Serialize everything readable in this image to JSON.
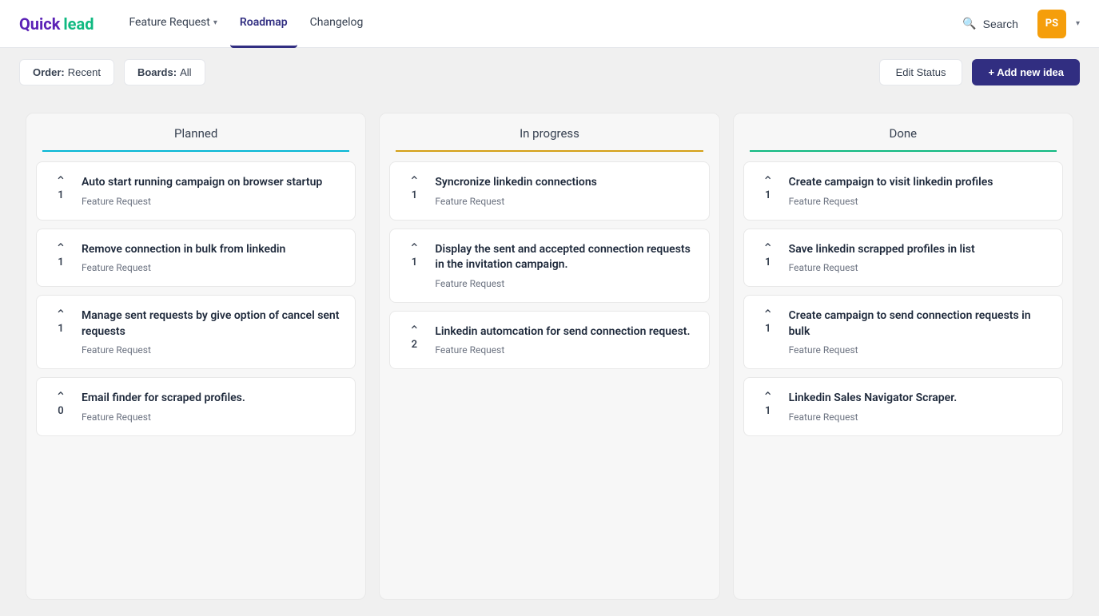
{
  "navbar": {
    "logo": {
      "quick": "Quick",
      "lead": "lead"
    },
    "nav_items": [
      {
        "label": "Feature Request",
        "has_chevron": true,
        "active": false
      },
      {
        "label": "Roadmap",
        "has_chevron": false,
        "active": true
      },
      {
        "label": "Changelog",
        "has_chevron": false,
        "active": false
      }
    ],
    "search_label": "Search",
    "avatar_initials": "PS",
    "avatar_color": "#f59e0b"
  },
  "toolbar": {
    "order_label": "Order:",
    "order_value": "Recent",
    "boards_label": "Boards:",
    "boards_value": "All",
    "edit_status_label": "Edit Status",
    "add_idea_label": "+ Add new idea"
  },
  "columns": [
    {
      "id": "planned",
      "title": "Planned",
      "style": "planned",
      "cards": [
        {
          "id": "p1",
          "votes": 1,
          "title": "Auto start running campaign on browser startup",
          "tag": "Feature Request"
        },
        {
          "id": "p2",
          "votes": 1,
          "title": "Remove connection in bulk from linkedin",
          "tag": "Feature Request"
        },
        {
          "id": "p3",
          "votes": 1,
          "title": "Manage sent requests by give option of cancel sent requests",
          "tag": "Feature Request"
        },
        {
          "id": "p4",
          "votes": 0,
          "title": "Email finder for scraped profiles.",
          "tag": "Feature Request"
        }
      ]
    },
    {
      "id": "inprogress",
      "title": "In progress",
      "style": "inprogress",
      "cards": [
        {
          "id": "i1",
          "votes": 1,
          "title": "Syncronize linkedin connections",
          "tag": "Feature Request"
        },
        {
          "id": "i2",
          "votes": 1,
          "title": "Display the sent and accepted connection requests in the invitation campaign.",
          "tag": "Feature Request"
        },
        {
          "id": "i3",
          "votes": 2,
          "title": "Linkedin automcation for send connection request.",
          "tag": "Feature Request"
        }
      ]
    },
    {
      "id": "done",
      "title": "Done",
      "style": "done",
      "cards": [
        {
          "id": "d1",
          "votes": 1,
          "title": "Create campaign to visit linkedin profiles",
          "tag": "Feature Request"
        },
        {
          "id": "d2",
          "votes": 1,
          "title": "Save linkedin scrapped profiles in list",
          "tag": "Feature Request"
        },
        {
          "id": "d3",
          "votes": 1,
          "title": "Create campaign to send connection requests in bulk",
          "tag": "Feature Request"
        },
        {
          "id": "d4",
          "votes": 1,
          "title": "Linkedin Sales Navigator Scraper.",
          "tag": "Feature Request"
        }
      ]
    }
  ]
}
